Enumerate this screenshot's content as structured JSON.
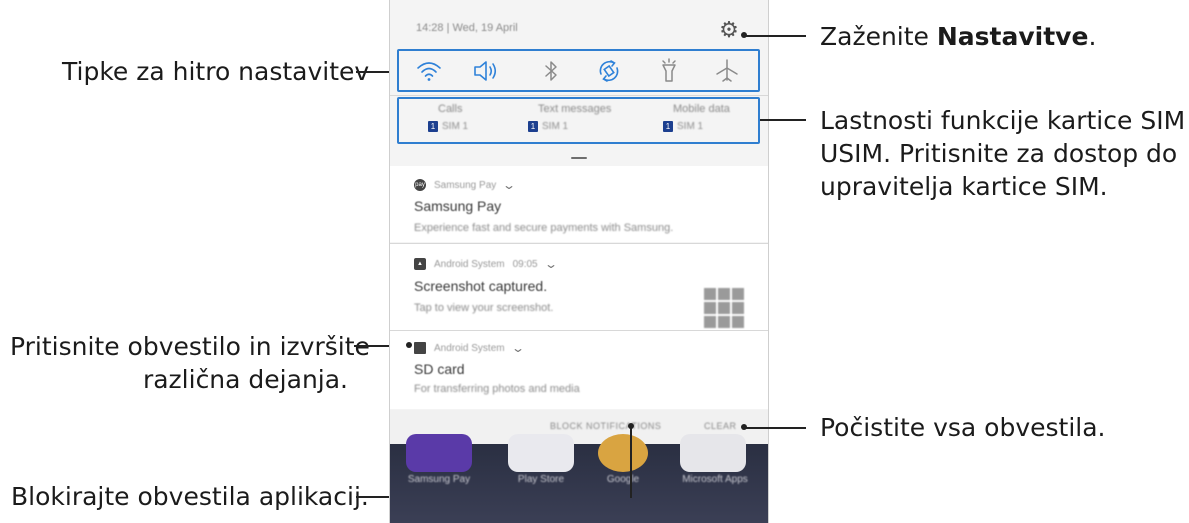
{
  "callouts": {
    "quick_settings": "Tipke za hitro nastavitev",
    "launch_settings_prefix": "Zaženite ",
    "launch_settings_bold": "Nastavitve",
    "launch_settings_suffix": ".",
    "sim_line1": "Lastnosti funkcije kartice SIM in",
    "sim_line2": "USIM. Pritisnite za dostop do",
    "sim_line3": "upravitelja kartice SIM.",
    "notif_line1": "Pritisnite obvestilo in izvršite",
    "notif_line2": "različna dejanja.",
    "clear_all": "Počistite vsa obvestila.",
    "block": "Blokirajte obvestila aplikacij."
  },
  "status_bar": {
    "datetime": "14:28 | Wed, 19 April",
    "settings_icon": "gear-icon"
  },
  "quick_settings": [
    {
      "name": "wifi",
      "icon": "wifi-icon",
      "color": "#2f82d9"
    },
    {
      "name": "sound",
      "icon": "speaker-icon",
      "color": "#2f82d9"
    },
    {
      "name": "bluetooth",
      "icon": "bluetooth-icon",
      "color": "#8a8a8a"
    },
    {
      "name": "auto-rotate",
      "icon": "rotate-icon",
      "color": "#2f82d9"
    },
    {
      "name": "flashlight",
      "icon": "flashlight-icon",
      "color": "#8a8a8a"
    },
    {
      "name": "airplane",
      "icon": "airplane-icon",
      "color": "#8a8a8a"
    }
  ],
  "sim_cards": [
    {
      "label": "Calls",
      "sim": "SIM 1",
      "chip": "1"
    },
    {
      "label": "Text messages",
      "sim": "SIM 1",
      "chip": "1"
    },
    {
      "label": "Mobile data",
      "sim": "SIM 1",
      "chip": "1"
    }
  ],
  "notifications": [
    {
      "app": "Samsung Pay",
      "app_icon": "samsung-pay-icon",
      "time": "",
      "title": "Samsung Pay",
      "body": "Experience fast and secure payments with Samsung."
    },
    {
      "app": "Android System",
      "app_icon": "image-icon",
      "time": "09:05",
      "title": "Screenshot captured.",
      "body": "Tap to view your screenshot."
    },
    {
      "app": "Android System",
      "app_icon": "sd-card-icon",
      "time": "",
      "title": "SD card",
      "body": "For transferring photos and media"
    }
  ],
  "actions": {
    "block": "BLOCK NOTIFICATIONS",
    "clear": "CLEAR"
  },
  "home_apps": [
    {
      "label": "Samsung Pay",
      "color": "#5a3aa8"
    },
    {
      "label": "Play Store",
      "color": "#e9e9ee"
    },
    {
      "label": "Google",
      "color": "#d9a441"
    },
    {
      "label": "Microsoft Apps",
      "color": "#e6e6ea"
    }
  ]
}
